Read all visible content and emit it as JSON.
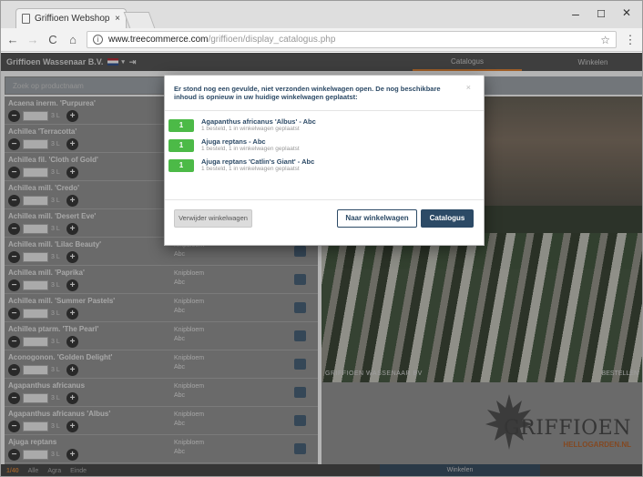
{
  "browser": {
    "tab_title": "Griffioen Webshop",
    "tab_close": "×",
    "url_host": "www.treecommerce.com",
    "url_path": "/griffioen/display_catalogus.php",
    "minimize": "–",
    "maximize": "☐",
    "close": "✕",
    "back": "←",
    "forward": "→",
    "reload": "C",
    "home": "⌂",
    "info": "i",
    "star": "☆",
    "menu": "⋮"
  },
  "app": {
    "company": "Griffioen Wassenaar B.V.",
    "caret": "▾",
    "logout": "⇥",
    "tab_catalogus": "Catalogus",
    "tab_winkelen": "Winkelen",
    "search_placeholder": "Zoek op productnaam"
  },
  "products": [
    {
      "name": "Acaena inerm. 'Purpurea'",
      "unit": "3 L",
      "type": "",
      "sub": ""
    },
    {
      "name": "Achillea 'Terracotta'",
      "unit": "3 L",
      "type": "",
      "sub": ""
    },
    {
      "name": "Achillea fil. 'Cloth of Gold'",
      "unit": "3 L",
      "type": "",
      "sub": ""
    },
    {
      "name": "Achillea mill. 'Credo'",
      "unit": "3 L",
      "type": "",
      "sub": ""
    },
    {
      "name": "Achillea mill. 'Desert Eve'",
      "unit": "3 L",
      "type": "",
      "sub": ""
    },
    {
      "name": "Achillea mill. 'Lilac Beauty'",
      "unit": "3 L",
      "type": "Knipbloem",
      "sub": "Abc"
    },
    {
      "name": "Achillea mill. 'Paprika'",
      "unit": "3 L",
      "type": "Knipbloem",
      "sub": "Abc"
    },
    {
      "name": "Achillea mill. 'Summer Pastels'",
      "unit": "3 L",
      "type": "Knipbloem",
      "sub": "Abc"
    },
    {
      "name": "Achillea ptarm. 'The Pearl'",
      "unit": "3 L",
      "type": "Knipbloem",
      "sub": "Abc"
    },
    {
      "name": "Aconogonon. 'Golden Delight'",
      "unit": "3 L",
      "type": "Knipbloem",
      "sub": "Abc"
    },
    {
      "name": "Agapanthus africanus",
      "unit": "3 L",
      "type": "Knipbloem",
      "sub": "Abc"
    },
    {
      "name": "Agapanthus africanus 'Albus'",
      "unit": "3 L",
      "type": "Knipbloem",
      "sub": "Abc"
    },
    {
      "name": "Ajuga reptans",
      "unit": "3 L",
      "type": "Knipbloem",
      "sub": "Abc"
    }
  ],
  "image": {
    "caption_left": "GRIFFIOEN WASSENAAR BV",
    "caption_right": "BESTELLEN"
  },
  "logo": {
    "name": "GRIFFIOEN",
    "sub": "HELLOGARDEN.NL"
  },
  "footer": {
    "page_count": "1/40",
    "link1": "Alle",
    "link2": "Agra",
    "link3": "Einde",
    "shop_button": "Winkelen"
  },
  "modal": {
    "message": "Er stond nog een gevulde, niet verzonden winkelwagen open. De nog beschikbare inhoud is opnieuw in uw huidige winkelwagen geplaatst:",
    "close": "×",
    "items": [
      {
        "qty": "1",
        "name": "Agapanthus africanus 'Albus' - Abc",
        "note": "1 besteld, 1 in winkelwagen geplaatst"
      },
      {
        "qty": "1",
        "name": "Ajuga reptans - Abc",
        "note": "1 besteld, 1 in winkelwagen geplaatst"
      },
      {
        "qty": "1",
        "name": "Ajuga reptans 'Catlin's Giant' - Abc",
        "note": "1 besteld, 1 in winkelwagen geplaatst"
      }
    ],
    "btn_remove": "Verwijder winkelwagen",
    "btn_cart": "Naar winkelwagen",
    "btn_catalog": "Catalogus"
  },
  "colors": {
    "accent_orange": "#e07b26",
    "navy": "#2c4a66",
    "green_badge": "#4cba47"
  }
}
